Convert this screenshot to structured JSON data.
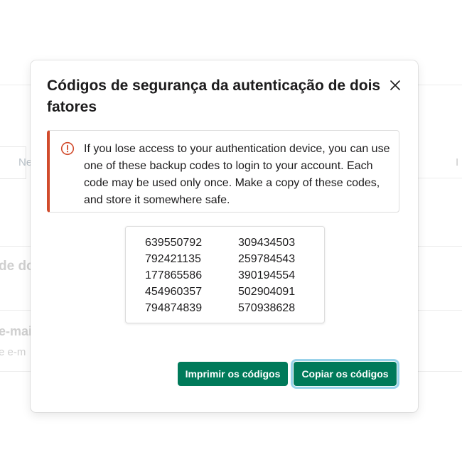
{
  "background": {
    "tab_fragment": "Ne",
    "right_fragment": "I",
    "heading_fragment_1": "de do",
    "heading_fragment_2": "e-mail",
    "sub_fragment_2": "e e-m"
  },
  "modal": {
    "title": "Códigos de segurança da autenticação de dois fatores",
    "close_icon": "close-icon",
    "warning": {
      "icon": "warning-circle-icon",
      "accent_color": "#d14b2c",
      "text": "If you lose access to your authentication device, you can use one of these backup codes to login to your account. Each code may be used only once. Make a copy of these codes, and store it somewhere safe."
    },
    "codes": [
      "639550792",
      "309434503",
      "792421135",
      "259784543",
      "177865586",
      "390194554",
      "454960357",
      "502904091",
      "794874839",
      "570938628"
    ],
    "buttons": {
      "print_label": "Imprimir os códigos",
      "copy_label": "Copiar os códigos",
      "color": "#007a5a"
    }
  }
}
